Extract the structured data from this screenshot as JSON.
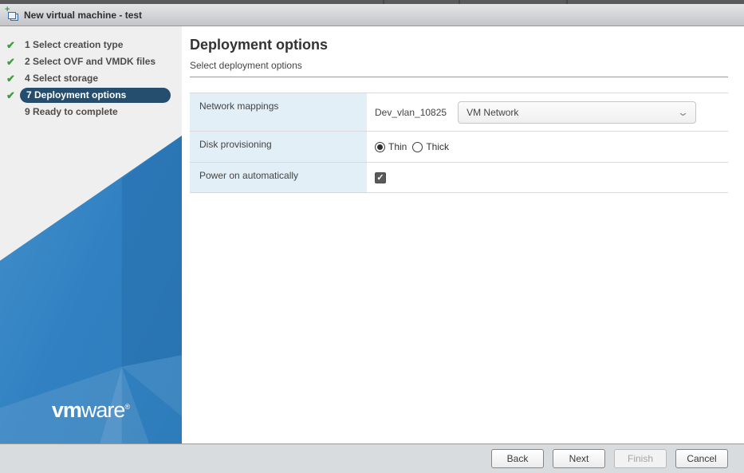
{
  "window": {
    "title": "New virtual machine - test",
    "icon": "new-vm-icon"
  },
  "sidebar": {
    "steps": [
      {
        "label": "1 Select creation type",
        "completed": true,
        "active": false
      },
      {
        "label": "2 Select OVF and VMDK files",
        "completed": true,
        "active": false
      },
      {
        "label": "4 Select storage",
        "completed": true,
        "active": false
      },
      {
        "label": "7 Deployment options",
        "completed": true,
        "active": true
      },
      {
        "label": "9 Ready to complete",
        "completed": false,
        "active": false
      }
    ],
    "logo": {
      "bold": "vm",
      "light": "ware",
      "reg": "®"
    }
  },
  "page": {
    "title": "Deployment options",
    "subtitle": "Select deployment options"
  },
  "form": {
    "rows": [
      {
        "label": "Network mappings"
      },
      {
        "label": "Disk provisioning"
      },
      {
        "label": "Power on automatically"
      }
    ],
    "network": {
      "source_label": "Dev_vlan_10825",
      "selected_option": "VM Network"
    },
    "disk": {
      "options": [
        {
          "label": "Thin",
          "selected": true
        },
        {
          "label": "Thick",
          "selected": false
        }
      ]
    },
    "power_on": {
      "checked": true,
      "checkmark": "✓"
    }
  },
  "footer": {
    "back_label": "Back",
    "next_label": "Next",
    "finish_label": "Finish",
    "cancel_label": "Cancel"
  },
  "glyphs": {
    "check": "✔",
    "chevron_down": "⌄"
  },
  "colors": {
    "accent_navy": "#254d6e",
    "sidebar_blue": "#3181c2",
    "check_green": "#3e9e3e",
    "label_cell_blue": "#e2eff7",
    "titlebar_gradient_top": "#e4e5e7",
    "titlebar_gradient_bottom": "#c3c5c8"
  }
}
